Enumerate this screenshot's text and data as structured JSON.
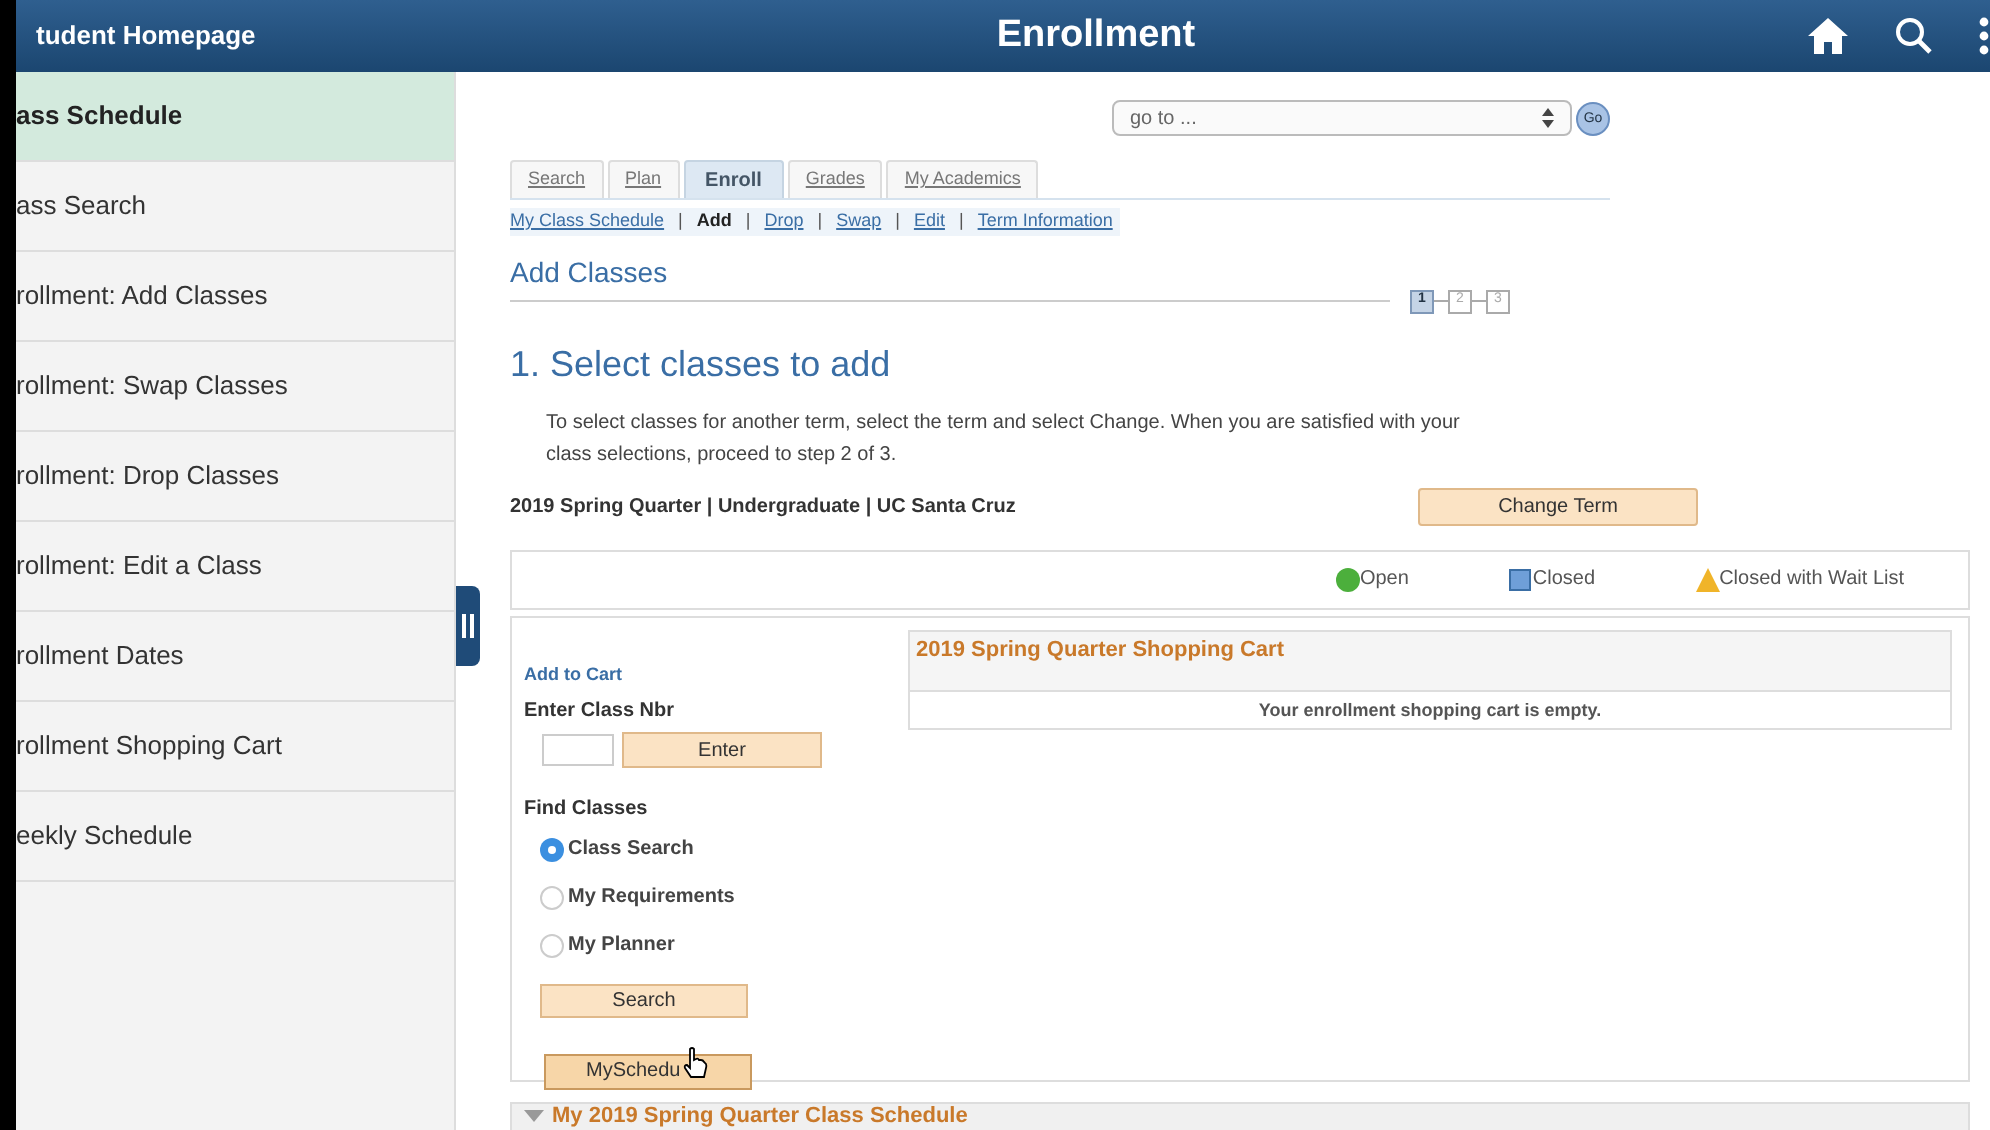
{
  "header": {
    "back_link": "tudent Homepage",
    "title": "Enrollment"
  },
  "sidebar": {
    "items": [
      {
        "label": "ass Schedule",
        "selected": true
      },
      {
        "label": "ass Search",
        "selected": false
      },
      {
        "label": "rollment:  Add Classes",
        "selected": false
      },
      {
        "label": "rollment:  Swap Classes",
        "selected": false
      },
      {
        "label": "rollment:  Drop Classes",
        "selected": false
      },
      {
        "label": "rollment:  Edit a Class",
        "selected": false
      },
      {
        "label": "rollment Dates",
        "selected": false
      },
      {
        "label": "rollment Shopping Cart",
        "selected": false
      },
      {
        "label": "eekly Schedule",
        "selected": false
      }
    ]
  },
  "goto": {
    "value": "go to ...",
    "button": "Go"
  },
  "tabs": [
    {
      "label": "Search",
      "selected": false
    },
    {
      "label": "Plan",
      "selected": false
    },
    {
      "label": "Enroll",
      "selected": true
    },
    {
      "label": "Grades",
      "selected": false
    },
    {
      "label": "My Academics",
      "selected": false
    }
  ],
  "subnav_separator": "|",
  "subnav": [
    {
      "label": "My Class Schedule",
      "selected": false
    },
    {
      "label": "Add",
      "selected": true
    },
    {
      "label": "Drop",
      "selected": false
    },
    {
      "label": "Swap",
      "selected": false
    },
    {
      "label": "Edit",
      "selected": false
    },
    {
      "label": "Term Information",
      "selected": false
    }
  ],
  "section_title": "Add Classes",
  "steps": [
    {
      "label": "1",
      "selected": true
    },
    {
      "label": "2",
      "selected": false
    },
    {
      "label": "3",
      "selected": false
    }
  ],
  "step_heading": "1.  Select classes to add",
  "instructions": "To select classes for another term, select the term and select Change.  When you are satisfied with your class selections, proceed to step 2 of 3.",
  "term": "2019 Spring Quarter | Undergraduate | UC Santa Cruz",
  "change_term_button": "Change Term",
  "legend": [
    {
      "kind": "circle",
      "label": "Open",
      "color": "#4caf3c"
    },
    {
      "kind": "square",
      "label": "Closed",
      "color": "#6f9fd8"
    },
    {
      "kind": "triangle",
      "label": "Closed with Wait List",
      "color": "#f0b429"
    }
  ],
  "add_to_cart": {
    "title": "Add to Cart",
    "class_nbr_label": "Enter Class Nbr",
    "enter_button": "Enter",
    "find_label": "Find Classes",
    "options": [
      {
        "label": "Class Search",
        "selected": true
      },
      {
        "label": "My Requirements",
        "selected": false
      },
      {
        "label": "My Planner",
        "selected": false
      }
    ],
    "search_button": "Search",
    "myschedule_button": "MySchedu"
  },
  "cart": {
    "title": "2019 Spring Quarter Shopping Cart",
    "message": "Your enrollment shopping cart is empty."
  },
  "schedule_section": {
    "title": "My 2019 Spring Quarter Class Schedule",
    "expanded": true
  }
}
